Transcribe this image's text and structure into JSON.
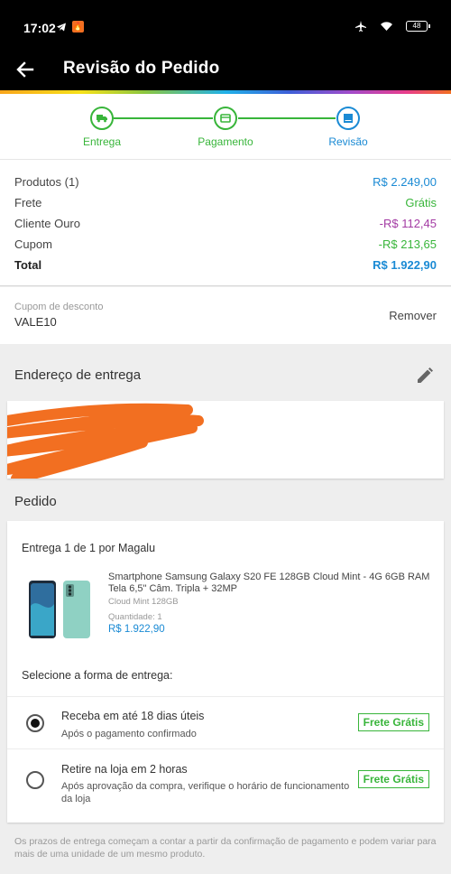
{
  "status_bar": {
    "time": "17:02",
    "battery": "48"
  },
  "app_bar": {
    "title": "Revisão do Pedido",
    "back_icon": "arrow-left-icon"
  },
  "stepper": {
    "steps": [
      {
        "label": "Entrega",
        "icon": "truck-icon",
        "state": "done"
      },
      {
        "label": "Pagamento",
        "icon": "card-icon",
        "state": "done"
      },
      {
        "label": "Revisão",
        "icon": "document-icon",
        "state": "active"
      }
    ],
    "colors": {
      "done": "#38b53a",
      "active": "#1a8ad4"
    }
  },
  "summary": {
    "rows": [
      {
        "label": "Produtos (1)",
        "value": "R$ 2.249,00",
        "color": "#1a8ad4"
      },
      {
        "label": "Frete",
        "value": "Grátis",
        "color": "#38b53a"
      },
      {
        "label": "Cliente Ouro",
        "value": "-R$ 112,45",
        "color": "#a33aa3"
      },
      {
        "label": "Cupom",
        "value": "-R$ 213,65",
        "color": "#38b53a"
      },
      {
        "label": "Total",
        "value": "R$ 1.922,90",
        "color": "#1a8ad4"
      }
    ]
  },
  "coupon": {
    "label": "Cupom de desconto",
    "code": "VALE10",
    "remove": "Remover"
  },
  "address": {
    "heading": "Endereço de entrega",
    "edit_icon": "pencil-icon"
  },
  "order": {
    "heading": "Pedido",
    "shipment_title": "Entrega 1 de 1 por Magalu",
    "product": {
      "name": "Smartphone Samsung Galaxy S20 FE 128GB Cloud Mint - 4G 6GB RAM Tela 6,5\" Câm. Tripla + 32MP",
      "variant": "Cloud Mint 128GB",
      "quantity": "Quantidade:  1",
      "price": "R$ 1.922,90"
    },
    "select_title": "Selecione a forma de entrega:",
    "options": [
      {
        "title": "Receba em até 18 dias úteis",
        "subtitle": "Após o pagamento confirmado",
        "badge": "Frete Grátis",
        "selected": true
      },
      {
        "title": "Retire na loja em 2 horas",
        "subtitle": "Após aprovação da compra, verifique o horário de funcionamento da loja",
        "badge": "Frete Grátis",
        "selected": false
      }
    ]
  },
  "footnote": "Os prazos de entrega começam a contar a partir da confirmação de pagamento e podem variar para mais de uma unidade de um mesmo produto."
}
